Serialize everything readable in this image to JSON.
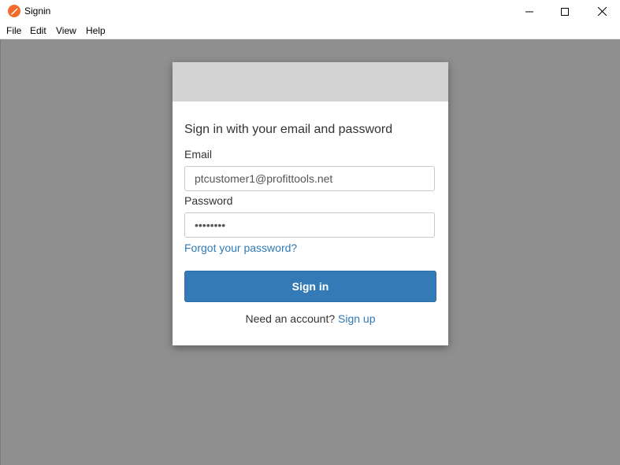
{
  "window": {
    "title": "Signin",
    "app_icon": "pen-icon",
    "controls": [
      "minimize-icon",
      "maximize-icon",
      "close-icon"
    ]
  },
  "menu": [
    "File",
    "Edit",
    "View",
    "Help"
  ],
  "signin": {
    "heading": "Sign in with your email and password",
    "email_label": "Email",
    "email_value": "ptcustomer1@profittools.net",
    "password_label": "Password",
    "password_value": "••••••••",
    "forgot_link": "Forgot your password?",
    "button_label": "Sign in",
    "no_account_text": "Need an account?",
    "signup_link": "Sign up"
  },
  "colors": {
    "accent": "#337ab7",
    "link": "#2f7ab5",
    "overlay": "#8f8f8f",
    "card_header": "#d3d3d3"
  }
}
